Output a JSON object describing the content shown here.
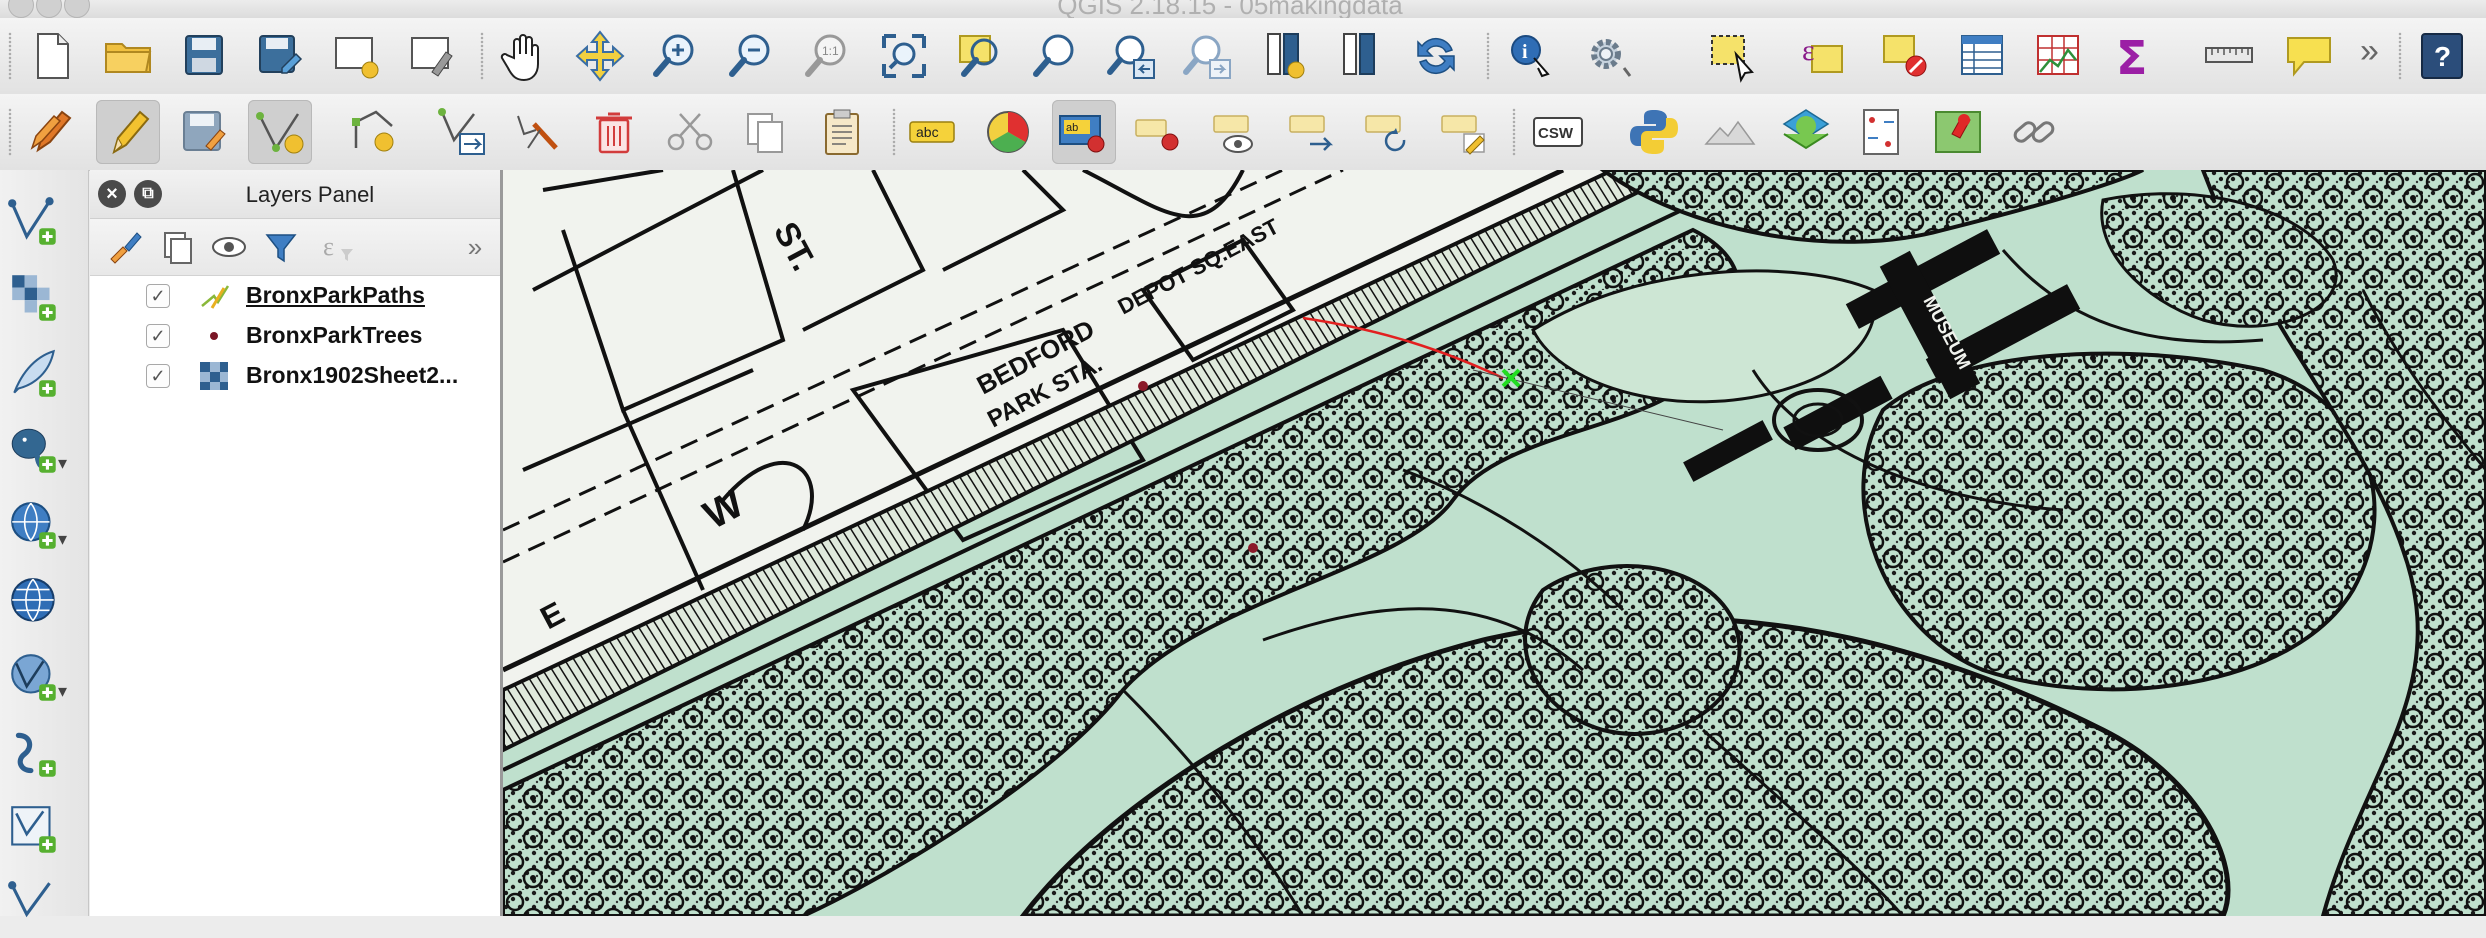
{
  "window": {
    "title": "QGIS 2.18.15 - 05makingdata"
  },
  "toolbar_file": {
    "tools": [
      "new-project",
      "open-project",
      "save-project",
      "save-as",
      "new-print-composer",
      "composer-manager"
    ]
  },
  "toolbar_map_nav": {
    "tools": [
      "pan",
      "pan-to-selection",
      "zoom-in",
      "zoom-out",
      "zoom-native",
      "zoom-full",
      "zoom-to-selection",
      "zoom-to-layer",
      "zoom-last",
      "zoom-next",
      "new-bookmark",
      "show-bookmarks",
      "refresh"
    ]
  },
  "toolbar_attributes": {
    "tools": [
      "identify",
      "run-feature-action",
      "select-features",
      "select-by-expression",
      "deselect-all",
      "open-attribute-table",
      "field-calculator",
      "statistical-summary",
      "measure",
      "map-tips"
    ]
  },
  "toolbar_digitizing": {
    "tools": [
      "current-edits",
      "toggle-editing",
      "save-layer-edits",
      "add-feature",
      "node-tool",
      "move-feature",
      "delete-selected",
      "cut-features",
      "copy-features",
      "paste-features"
    ]
  },
  "toolbar_labels": {
    "tools": [
      "layer-labeling",
      "layer-diagram",
      "highlight-pinned-labels",
      "pin-unpin-labels",
      "show-hide-labels",
      "move-label",
      "rotate-label",
      "change-label"
    ],
    "abc_text": "abc",
    "ab_text": "ab"
  },
  "toolbar_plugins": {
    "csw_label": "CSW",
    "tools": [
      "metasearch",
      "python-console",
      "terrain-plugin",
      "qgis-cloud",
      "geo-referencer",
      "gps-tools",
      "connect"
    ]
  },
  "overflow_chevron": "»",
  "left_toolbar": {
    "tools": [
      "add-vector-layer",
      "add-raster-layer",
      "add-delimited-text-layer",
      "add-postgis-layer",
      "add-spatialite-layer",
      "add-wms-layer",
      "add-wfs-layer",
      "add-wcs-layer",
      "add-virtual-layer",
      "new-shapefile-layer"
    ],
    "dropdown_glyph": "▾"
  },
  "layers_panel": {
    "title": "Layers Panel",
    "close_glyph": "×",
    "float_glyph": "⧉",
    "more_glyph": "»",
    "check_glyph": "✓",
    "layers": [
      {
        "name": "BronxParkPaths",
        "checked": true,
        "type": "line",
        "underline": true
      },
      {
        "name": "BronxParkTrees",
        "checked": true,
        "type": "point",
        "underline": false
      },
      {
        "name": "Bronx1902Sheet2...",
        "checked": true,
        "type": "raster",
        "underline": false
      }
    ]
  },
  "map": {
    "labels": [
      "BEDFORD",
      "PARK STA.",
      "DEPOT SQ.EAST",
      "W",
      "E",
      "MUSEUM",
      "ST."
    ],
    "colors": {
      "background": "#bfe0cd",
      "ink": "#1a1a1a",
      "digitized_path": "#e22020",
      "vertex_marker": "#22dd22",
      "tree_point": "#8b1a2a"
    }
  }
}
